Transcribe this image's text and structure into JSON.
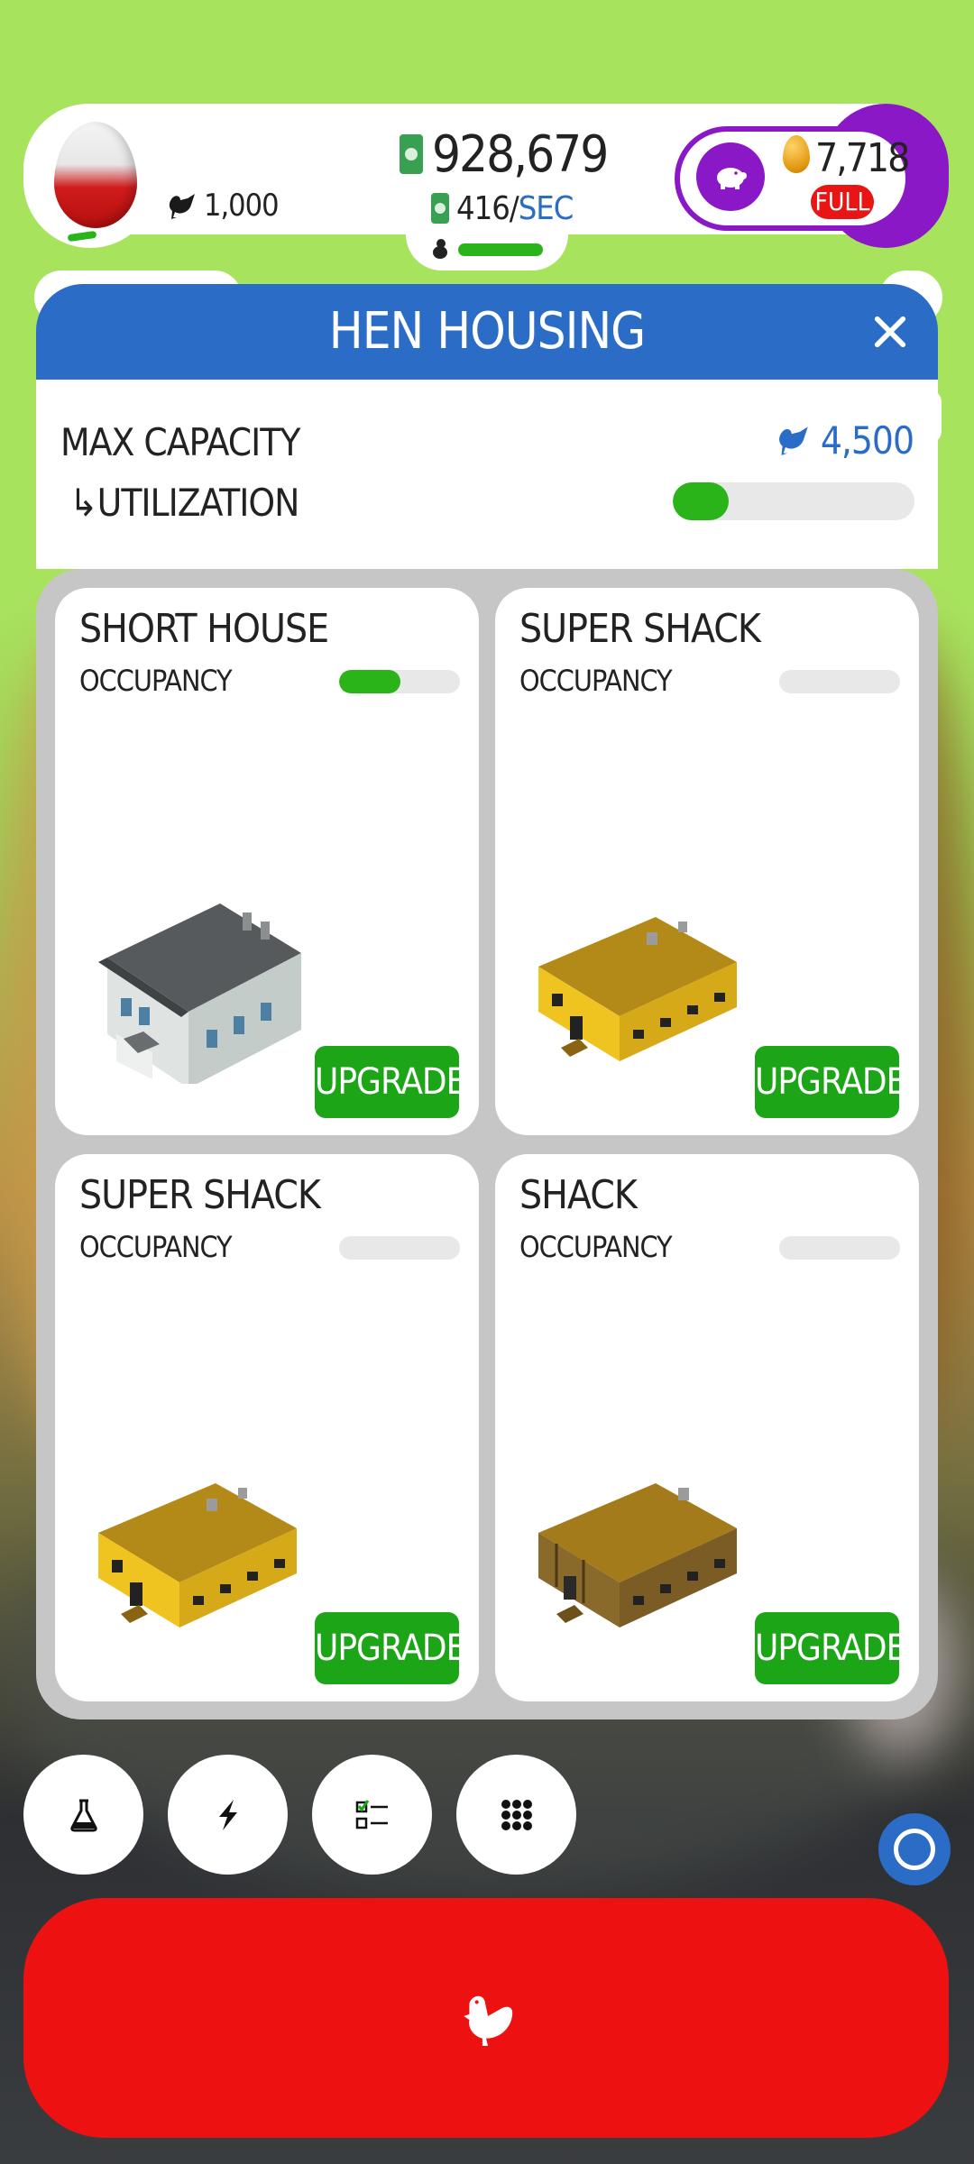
{
  "header": {
    "hen_count": "1,000",
    "money": "928,679",
    "money_rate_value": "416/",
    "money_rate_unit": "SEC",
    "golden_eggs": "7,718",
    "piggy_bank_status": "FULL"
  },
  "panel": {
    "title": "HEN HOUSING",
    "max_capacity_label": "MAX CAPACITY",
    "max_capacity_value": "4,500",
    "utilization_label": "↳UTILIZATION",
    "utilization_fraction": 0.23
  },
  "houses": [
    {
      "name": "SHORT HOUSE",
      "occupancy_label": "OCCUPANCY",
      "occupancy_fraction": 0.51,
      "upgrade_label": "UPGRADE",
      "style": "gray"
    },
    {
      "name": "SUPER SHACK",
      "occupancy_label": "OCCUPANCY",
      "occupancy_fraction": 0,
      "upgrade_label": "UPGRADE",
      "style": "yellow"
    },
    {
      "name": "SUPER SHACK",
      "occupancy_label": "OCCUPANCY",
      "occupancy_fraction": 0,
      "upgrade_label": "UPGRADE",
      "style": "yellow"
    },
    {
      "name": "SHACK",
      "occupancy_label": "OCCUPANCY",
      "occupancy_fraction": 0,
      "upgrade_label": "UPGRADE",
      "style": "brown"
    }
  ],
  "toolbar": {
    "icons": [
      "flask-icon",
      "lightning-icon",
      "checklist-icon",
      "grid-menu-icon"
    ]
  },
  "colors": {
    "accent_blue": "#2a6cc6",
    "progress_green": "#2bb31a",
    "upgrade_green": "#1ca517",
    "hatch_red": "#ee1111",
    "piggy_purple": "#8a18c6"
  }
}
